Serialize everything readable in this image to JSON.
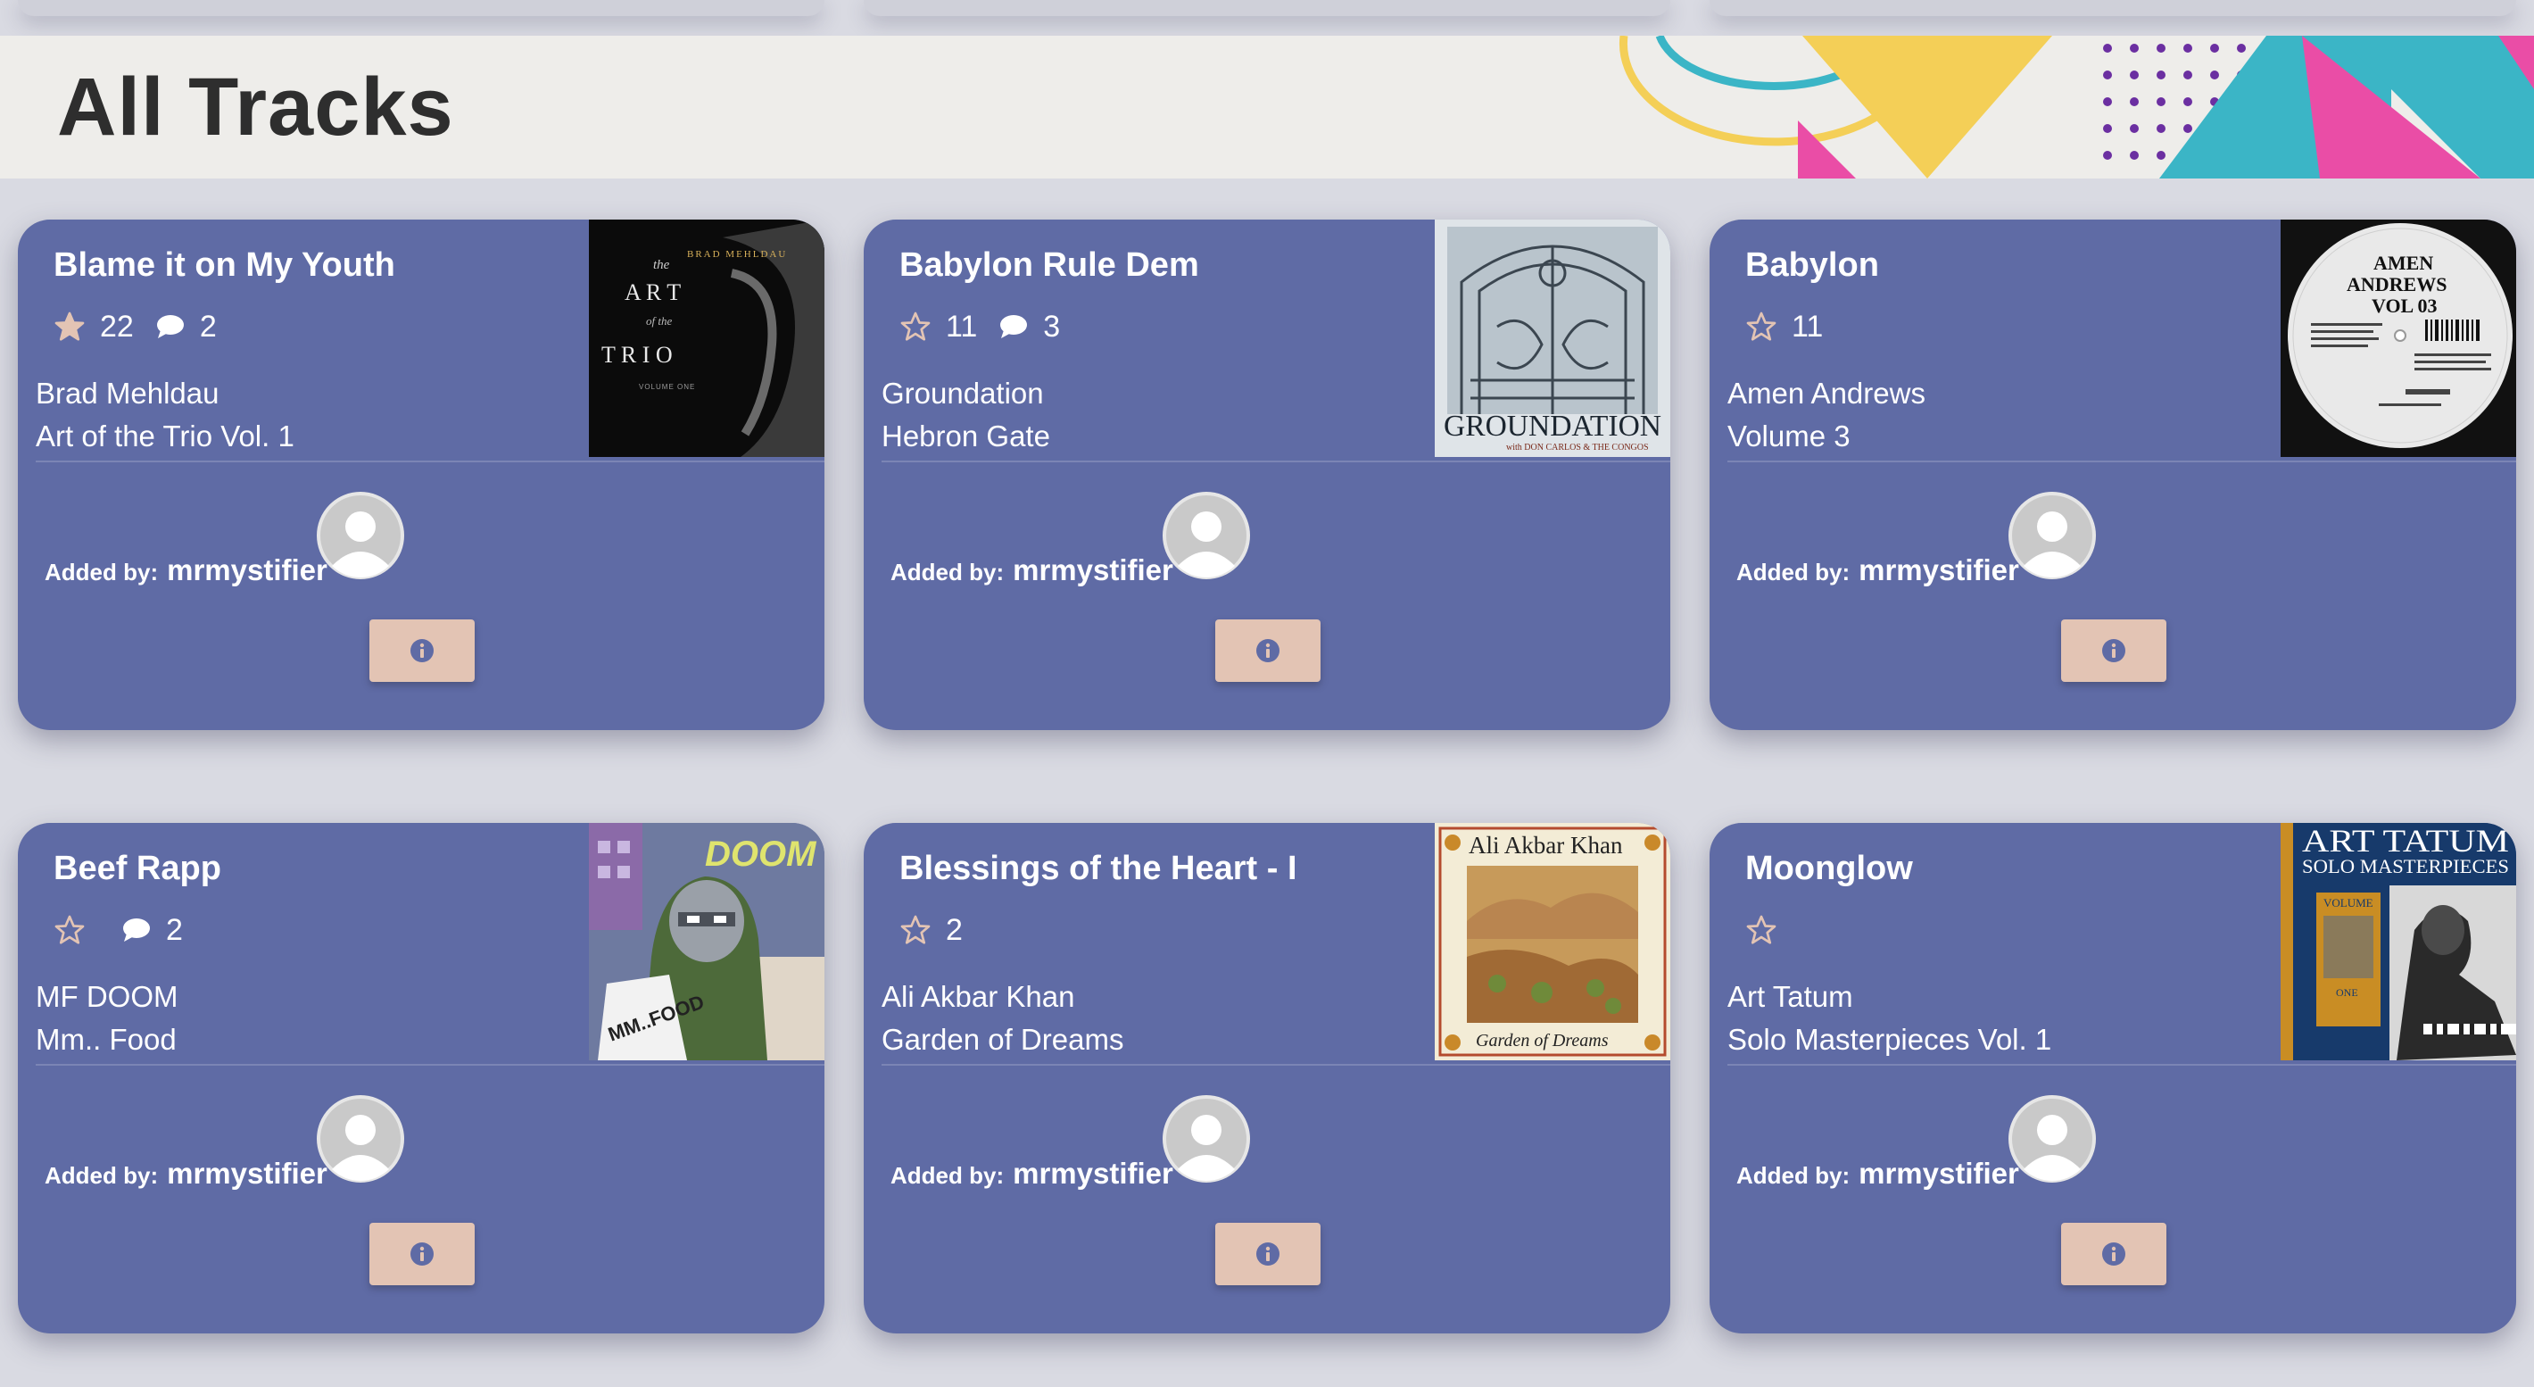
{
  "header": {
    "title": "All Tracks"
  },
  "colors": {
    "card": "#5f6ba5",
    "info_button": "#e3c4b4",
    "header_bg": "#eeedea",
    "page_bg": "#d9dae2",
    "star_filled": "#e3c4b4"
  },
  "added_by_label": "Added by:",
  "tracks": [
    {
      "title": "Blame it on My Youth",
      "rating": "22",
      "rated": true,
      "comments": "2",
      "artist": "Brad Mehldau",
      "album": "Art of the Trio Vol. 1",
      "user": "mrmystifier",
      "art": {
        "band": "BRAD MEHLDAU",
        "line1": "the",
        "line2": "A R T",
        "line3": "of the",
        "line4": "T R I O",
        "line5": "VOLUME ONE"
      }
    },
    {
      "title": "Babylon Rule Dem",
      "rating": "11",
      "rated": false,
      "comments": "3",
      "artist": "Groundation",
      "album": "Hebron Gate",
      "user": "mrmystifier",
      "art": {
        "band": "GROUNDATION",
        "sub": "with DON CARLOS & THE CONGOS"
      }
    },
    {
      "title": "Babylon",
      "rating": "11",
      "rated": false,
      "comments": "",
      "artist": "Amen Andrews",
      "album": "Volume 3",
      "user": "mrmystifier",
      "art": {
        "line1": "AMEN",
        "line2": "ANDREWS",
        "line3": "VOL 03"
      }
    },
    {
      "title": "Beef Rapp",
      "rating": "",
      "rated": false,
      "comments": "2",
      "artist": "MF DOOM",
      "album": "Mm.. Food",
      "user": "mrmystifier",
      "art": {
        "logo": "DOOM",
        "sub": "MM..FOOD"
      }
    },
    {
      "title": "Blessings of the Heart - I",
      "rating": "2",
      "rated": false,
      "comments": "",
      "artist": "Ali Akbar Khan",
      "album": "Garden of Dreams",
      "user": "mrmystifier",
      "art": {
        "band": "Ali Akbar Khan",
        "sub": "Garden of Dreams"
      }
    },
    {
      "title": "Moonglow",
      "rating": "",
      "rated": false,
      "comments": "",
      "artist": "Art Tatum",
      "album": "Solo Masterpieces Vol. 1",
      "user": "mrmystifier",
      "art": {
        "line1": "ART TATUM",
        "line2": "SOLO MASTERPIECES",
        "line3": "VOLUME",
        "line4": "ONE"
      }
    }
  ]
}
